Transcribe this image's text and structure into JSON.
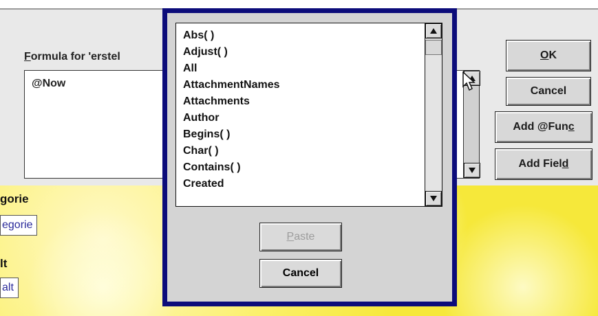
{
  "form": {
    "field1_label": "gorie",
    "field1_value": "egorie",
    "field2_label": "lt",
    "field2_value": "alt"
  },
  "formula_dialog": {
    "label_prefix": "F",
    "label_rest": "ormula for 'erstel",
    "formula_text": "@Now",
    "ok_button_prefix": "",
    "ok_button_ul": "O",
    "ok_button_rest": "K",
    "cancel_button": "Cancel",
    "add_func_prefix": "Add @Fun",
    "add_func_ul": "c",
    "add_field_prefix": "Add Fiel",
    "add_field_ul": "d"
  },
  "func_list_dialog": {
    "items": [
      "Abs( )",
      "Adjust( )",
      "All",
      "AttachmentNames",
      "Attachments",
      "Author",
      "Begins( )",
      "Char( )",
      "Contains( )",
      "Created"
    ],
    "paste_button_ul": "P",
    "paste_button_rest": "aste",
    "cancel_button": "Cancel"
  },
  "icons": {
    "scroll_up": "scroll-up-arrow-icon",
    "scroll_down": "scroll-down-arrow-icon",
    "cursor": "mouse-pointer-icon"
  }
}
